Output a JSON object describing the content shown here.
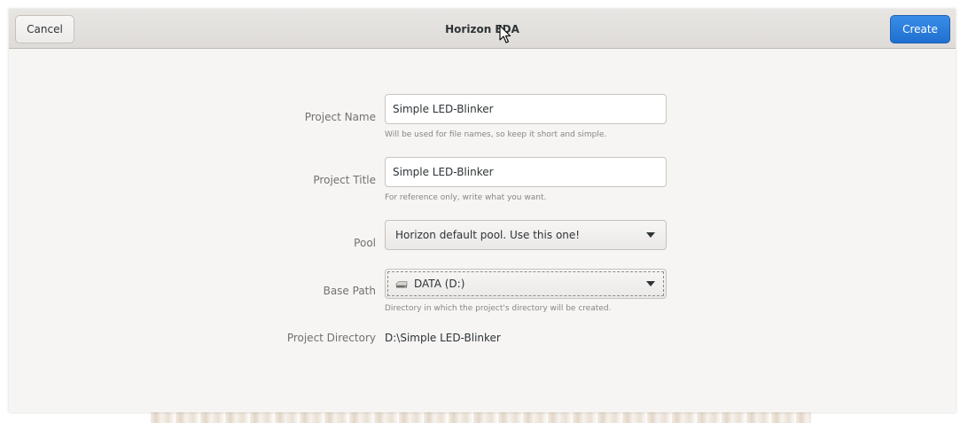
{
  "window": {
    "title": "Horizon EDA"
  },
  "header": {
    "cancel_label": "Cancel",
    "create_label": "Create"
  },
  "form": {
    "project_name": {
      "label": "Project Name",
      "value": "Simple LED-Blinker",
      "hint": "Will be used for file names, so keep it short and simple."
    },
    "project_title": {
      "label": "Project Title",
      "value": "Simple LED-Blinker",
      "hint": "For reference only, write what you want."
    },
    "pool": {
      "label": "Pool",
      "selected": "Horizon default pool. Use this one!"
    },
    "base_path": {
      "label": "Base Path",
      "selected": "DATA (D:)",
      "icon": "drive-icon",
      "hint": "Directory in which the project's directory will be created."
    },
    "project_directory": {
      "label": "Project Directory",
      "value": "D:\\Simple LED-Blinker"
    }
  },
  "colors": {
    "accent": "#1f6fd0",
    "window_bg": "#f6f5f4",
    "header_bg": "#dedbd8"
  }
}
